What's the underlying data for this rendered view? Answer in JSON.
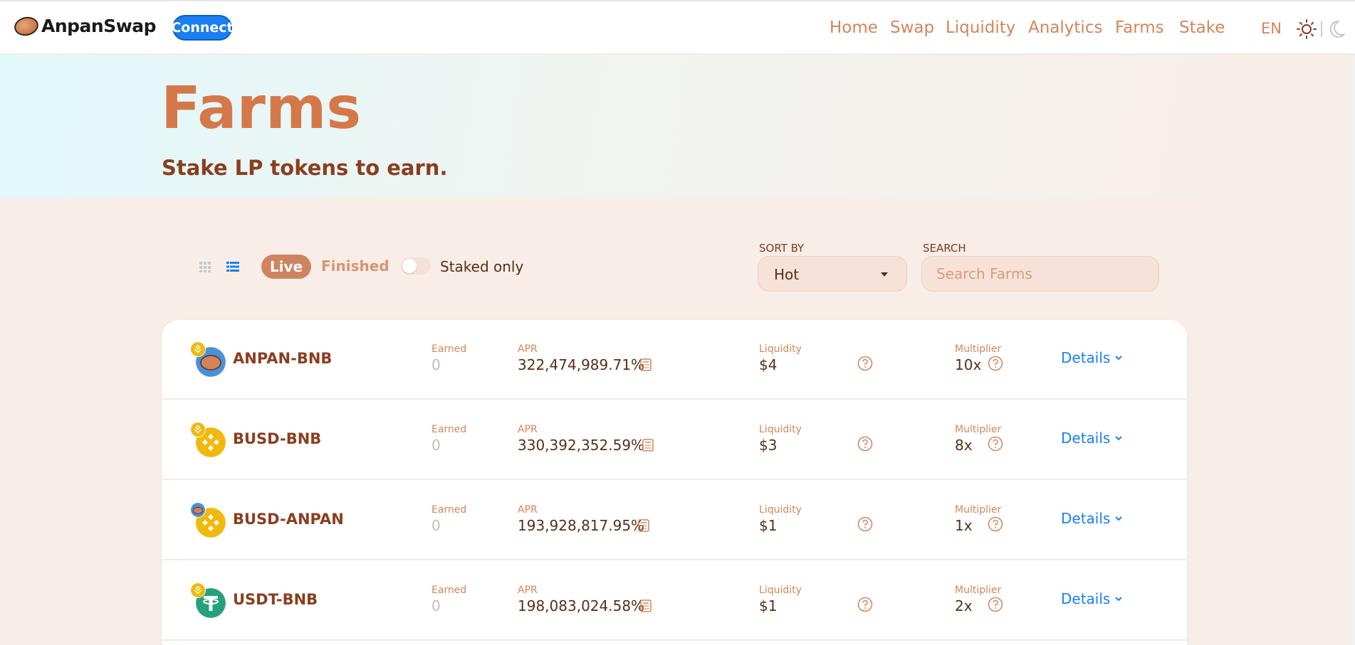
{
  "header": {
    "logo_text": "AnpanSwap",
    "connect_label": "Connect",
    "nav": [
      "Home",
      "Swap",
      "Liquidity",
      "Analytics",
      "Farms",
      "Stake"
    ],
    "lang": "EN"
  },
  "hero": {
    "title": "Farms",
    "subtitle": "Stake LP tokens to earn."
  },
  "controls": {
    "tab_live": "Live",
    "tab_finished": "Finished",
    "staked_only": "Staked only",
    "sort_label": "SORT BY",
    "sort_value": "Hot",
    "search_label": "SEARCH",
    "search_placeholder": "Search Farms"
  },
  "labels": {
    "earned": "Earned",
    "apr": "APR",
    "liquidity": "Liquidity",
    "multiplier": "Multiplier",
    "details": "Details"
  },
  "farms": [
    {
      "pair": "ANPAN-BNB",
      "earned": "0",
      "apr": "322,474,989.71%",
      "liquidity": "$4",
      "multiplier": "10x",
      "main_token": "ANPAN",
      "quote_token": "BNB"
    },
    {
      "pair": "BUSD-BNB",
      "earned": "0",
      "apr": "330,392,352.59%",
      "liquidity": "$3",
      "multiplier": "8x",
      "main_token": "BUSD",
      "quote_token": "BNB"
    },
    {
      "pair": "BUSD-ANPAN",
      "earned": "0",
      "apr": "193,928,817.95%",
      "liquidity": "$1",
      "multiplier": "1x",
      "main_token": "BUSD",
      "quote_token": "ANPAN"
    },
    {
      "pair": "USDT-BNB",
      "earned": "0",
      "apr": "198,083,024.58%",
      "liquidity": "$1",
      "multiplier": "2x",
      "main_token": "USDT",
      "quote_token": "BNB"
    }
  ],
  "colors": {
    "accent": "#d4845a",
    "brown": "#8a3e1e",
    "link": "#1a7ff0",
    "live_tab": "#cf8461"
  }
}
